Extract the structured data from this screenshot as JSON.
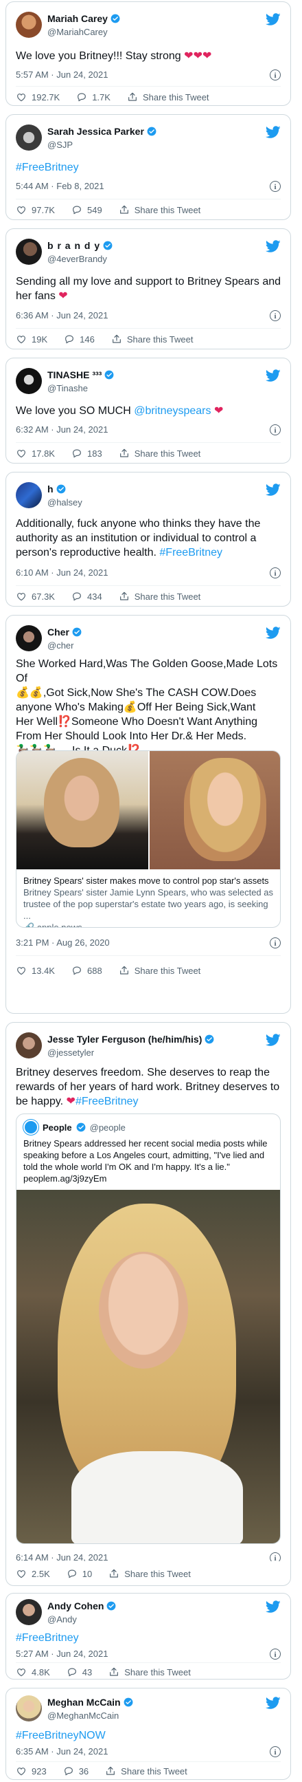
{
  "tweets": [
    {
      "name": "Mariah Carey",
      "handle": "@MariahCarey",
      "text": "We love you Britney!!! Stay strong ",
      "hearts": "❤❤❤",
      "time": "5:57 AM · Jun 24, 2021",
      "likes": "192.7K",
      "replies": "1.7K",
      "share": "Share this Tweet"
    },
    {
      "name": "Sarah Jessica Parker",
      "handle": "@SJP",
      "text": "#FreeBritney",
      "time": "5:44 AM · Feb 8, 2021",
      "likes": "97.7K",
      "replies": "549",
      "share": "Share this Tweet"
    },
    {
      "name": "b r a n d y",
      "handle": "@4everBrandy",
      "text": "Sending all my love and support to Britney Spears and her fans ",
      "hearts": "❤",
      "time": "6:36 AM · Jun 24, 2021",
      "likes": "19K",
      "replies": "146",
      "share": "Share this Tweet"
    },
    {
      "name": "TINASHE ³³³",
      "handle": "@Tinashe",
      "text": "We love you SO MUCH ",
      "mention": "@britneyspears",
      "hearts": "❤",
      "time": "6:32 AM · Jun 24, 2021",
      "likes": "17.8K",
      "replies": "183",
      "share": "Share this Tweet"
    },
    {
      "name": "h",
      "handle": "@halsey",
      "text": "Additionally, fuck anyone who thinks they have the authority as an institution or individual to control a person's reproductive health. ",
      "hashtag": "#FreeBritney",
      "time": "6:10 AM · Jun 24, 2021",
      "likes": "67.3K",
      "replies": "434",
      "share": "Share this Tweet"
    },
    {
      "name": "Cher",
      "handle": "@cher",
      "text_lines": [
        "She Worked Hard,Was The Golden Goose,Made Lots Of",
        "💰💰,Got Sick,Now She's The CASH COW.Does",
        "anyone Who's Making💰Off Her Being Sick,Want",
        "Her Well⁉️Someone Who Doesn't Want Anything",
        "From Her Should Look Into Her Dr.& Her Meds.",
        "🦆🦆🦆.....Is It a Duck⁉️"
      ],
      "card_title": "Britney Spears' sister makes move to control pop star's assets",
      "card_desc": "Britney Spears' sister Jamie Lynn Spears, who was selected as trustee of the pop superstar's estate two years ago, is seeking ...",
      "card_domain": "apple.news",
      "time": "3:21 PM · Aug 26, 2020",
      "likes": "13.4K",
      "replies": "688",
      "share": "Share this Tweet"
    },
    {
      "name": "Jesse Tyler Ferguson (he/him/his)",
      "handle": "@jessetyler",
      "text": "Britney deserves freedom. She deserves to reap the rewards of her years of hard work. Britney deserves to be happy. ",
      "hearts": "❤",
      "hashtag": "#FreeBritney",
      "quote_name": "People",
      "quote_handle": "@people",
      "quote_text": "Britney Spears addressed her recent social media posts while speaking before a Los Angeles court, admitting, \"I've lied and told the whole world I'm OK and I'm happy. It's a lie.\"",
      "quote_link": "peoplem.ag/3j9zyEm",
      "time": "6:14 AM · Jun 24, 2021",
      "likes": "2.5K",
      "replies": "10",
      "share": "Share this Tweet"
    },
    {
      "name": "Andy Cohen",
      "handle": "@Andy",
      "text": "#FreeBritney",
      "time": "5:27 AM · Jun 24, 2021",
      "likes": "4.8K",
      "replies": "43",
      "share": "Share this Tweet"
    },
    {
      "name": "Meghan McCain",
      "handle": "@MeghanMcCain",
      "text": "#FreeBritneyNOW",
      "time": "6:35 AM · Jun 24, 2021",
      "likes": "923",
      "replies": "36",
      "share": "Share this Tweet"
    }
  ],
  "icons": {
    "bird": "twitter-bird-icon",
    "verified": "verified-badge-icon",
    "like": "heart-outline-icon",
    "reply": "speech-bubble-icon",
    "share": "share-upload-icon",
    "info": "info-icon"
  },
  "colors": {
    "twitter_blue": "#1d9bf0",
    "heart_red": "#e0245e",
    "text": "#0f1419",
    "muted": "#536471",
    "border": "#cfd9de"
  }
}
